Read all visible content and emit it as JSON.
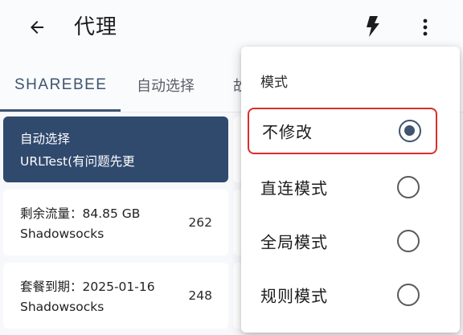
{
  "appbar": {
    "title": "代理",
    "back_icon": "arrow-left-icon",
    "bolt_icon": "lightning-bolt-icon",
    "more_icon": "more-vertical-icon"
  },
  "tabs": [
    {
      "label": "SHAREBEE",
      "active": true
    },
    {
      "label": "自动选择",
      "active": false
    },
    {
      "label": "故",
      "active": false
    }
  ],
  "proxies": [
    {
      "line1": "自动选择",
      "line2": "URLTest(有问题先更",
      "num": "",
      "selected": true
    },
    {
      "line1": "剩余流量：84.85 GB",
      "line2": "Shadowsocks",
      "num": "262",
      "selected": false
    },
    {
      "line1": "套餐到期：2025-01-16",
      "line2": "Shadowsocks",
      "num": "248",
      "selected": false
    }
  ],
  "menu": {
    "header": "模式",
    "items": [
      {
        "label": "不修改",
        "checked": true
      },
      {
        "label": "直连模式",
        "checked": false
      },
      {
        "label": "全局模式",
        "checked": false
      },
      {
        "label": "规则模式",
        "checked": false
      }
    ]
  },
  "colors": {
    "accent": "#3e5470",
    "selected_card": "#304a6e",
    "highlight_border": "#dd2c2c"
  }
}
